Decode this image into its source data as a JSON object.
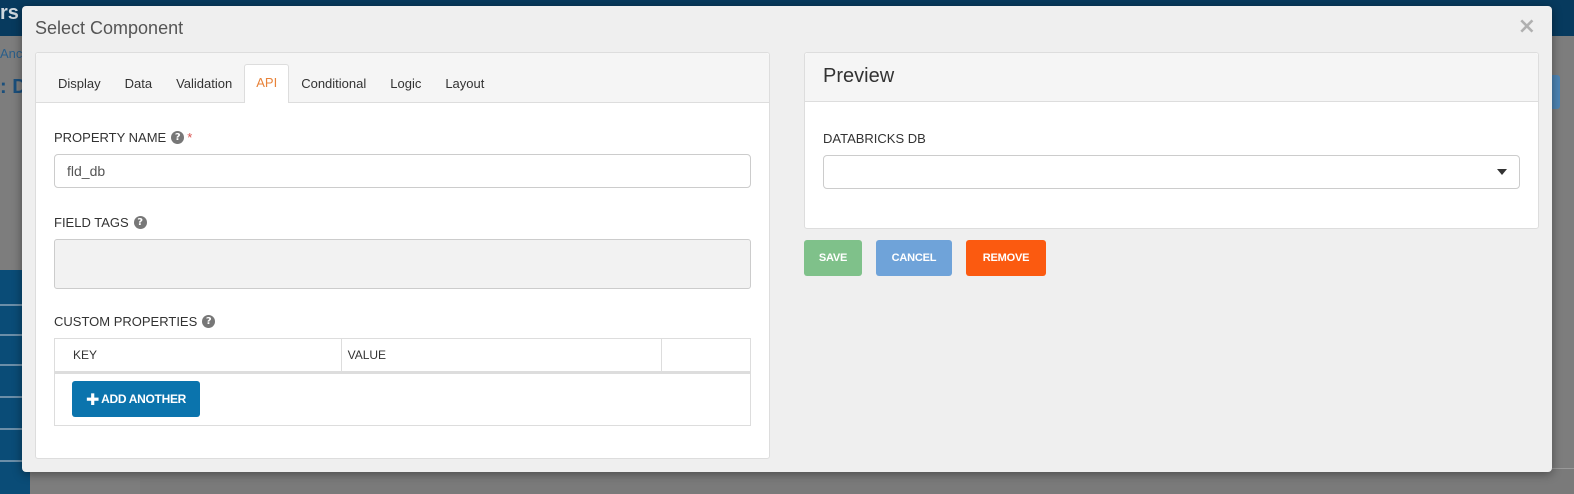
{
  "background": {
    "brand": "rs",
    "sub": "Anc",
    "title": ": D"
  },
  "modal": {
    "title": "Select Component",
    "close": "×"
  },
  "tabs": [
    {
      "label": "Display"
    },
    {
      "label": "Data"
    },
    {
      "label": "Validation"
    },
    {
      "label": "API"
    },
    {
      "label": "Conditional"
    },
    {
      "label": "Logic"
    },
    {
      "label": "Layout"
    }
  ],
  "active_tab": "API",
  "form": {
    "property_name_label": "PROPERTY NAME",
    "property_name_required": "*",
    "property_name_value": "fld_db",
    "field_tags_label": "FIELD TAGS",
    "custom_properties_label": "CUSTOM PROPERTIES",
    "table_headers": {
      "key": "KEY",
      "value": "VALUE",
      "actions": ""
    },
    "add_another_label": "ADD ANOTHER",
    "help_glyph": "?"
  },
  "preview": {
    "title": "Preview",
    "field_label": "DATABRICKS DB",
    "field_value": ""
  },
  "buttons": {
    "save": "SAVE",
    "cancel": "CANCEL",
    "remove": "REMOVE"
  },
  "colors": {
    "active_tab": "#e8833a",
    "add_button": "#0b74ad",
    "save_button": "#7fc18a",
    "cancel_button": "#6fa3d9",
    "remove_button": "#fb5a10",
    "required": "#d9534f"
  },
  "icons": {
    "help": "question-circle-icon",
    "plus": "plus-icon",
    "caret": "caret-down-icon",
    "close": "close-icon"
  }
}
